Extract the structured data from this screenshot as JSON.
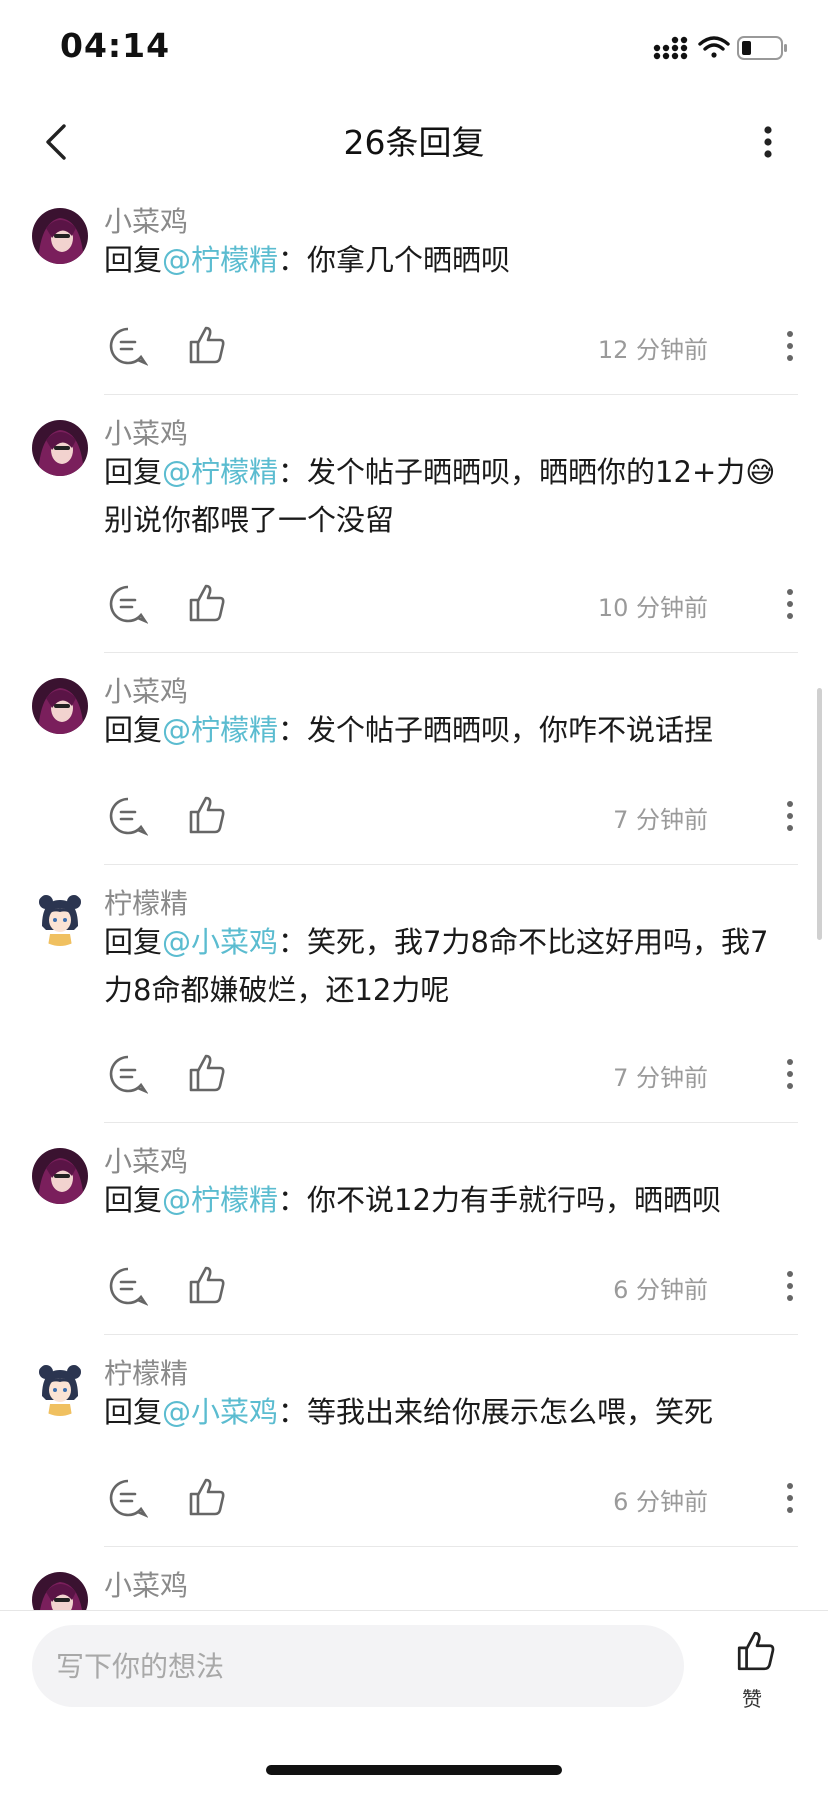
{
  "status": {
    "time": "04:14"
  },
  "header": {
    "title": "26条回复"
  },
  "comments": [
    {
      "user": "小菜鸡",
      "avatar": "purple-hair-avatar",
      "prefix": "回复",
      "mention": "@柠檬精",
      "sep": "：",
      "text": "你拿几个晒晒呗",
      "time": "12 分钟前"
    },
    {
      "user": "小菜鸡",
      "avatar": "purple-hair-avatar",
      "prefix": "回复",
      "mention": "@柠檬精",
      "sep": "：",
      "text": "发个帖子晒晒呗，晒晒你的12+力",
      "emoji": "😅",
      "text2": "别说你都喂了一个没留",
      "time": "10 分钟前"
    },
    {
      "user": "小菜鸡",
      "avatar": "purple-hair-avatar",
      "prefix": "回复",
      "mention": "@柠檬精",
      "sep": "：",
      "text": "发个帖子晒晒呗，你咋不说话捏",
      "time": "7 分钟前"
    },
    {
      "user": "柠檬精",
      "avatar": "anime-girl-avatar",
      "prefix": "回复",
      "mention": "@小菜鸡",
      "sep": "：",
      "text": "笑死，我7力8命不比这好用吗，我7力8命都嫌破烂，还12力呢",
      "time": "7 分钟前"
    },
    {
      "user": "小菜鸡",
      "avatar": "purple-hair-avatar",
      "prefix": "回复",
      "mention": "@柠檬精",
      "sep": "：",
      "text": "你不说12力有手就行吗，晒晒呗",
      "time": "6 分钟前"
    },
    {
      "user": "柠檬精",
      "avatar": "anime-girl-avatar",
      "prefix": "回复",
      "mention": "@小菜鸡",
      "sep": "：",
      "text": "等我出来给你展示怎么喂，笑死",
      "time": "6 分钟前"
    },
    {
      "user": "小菜鸡",
      "avatar": "purple-hair-avatar"
    }
  ],
  "composer": {
    "placeholder": "写下你的想法",
    "like_label": "赞"
  },
  "colors": {
    "mention": "#5bbcd0",
    "name": "#8a8a8a",
    "timestamp": "#9a9a9a"
  }
}
